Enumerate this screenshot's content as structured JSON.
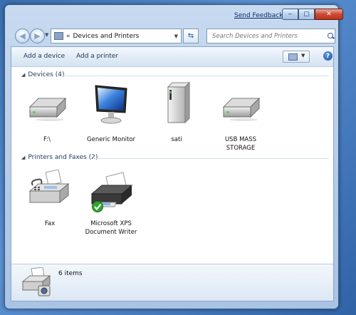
{
  "title_bar": {
    "send_feedback": "Send Feedback",
    "min_glyph": "‒",
    "max_glyph": "▢",
    "close_glyph": "✕"
  },
  "nav": {
    "back_glyph": "◀",
    "forward_glyph": "▶",
    "breadcrumb_separator": "«",
    "breadcrumb": "Devices and Printers",
    "refresh_glyph": "⇆",
    "search_placeholder": "Search Devices and Printers"
  },
  "toolbar": {
    "add_device": "Add a device",
    "add_printer": "Add a printer",
    "help": "?"
  },
  "groups": [
    {
      "header": "Devices (4)",
      "items": [
        {
          "label": [
            "F:\\"
          ],
          "icon": "external-drive-icon"
        },
        {
          "label": [
            "Generic Monitor"
          ],
          "icon": "monitor-icon"
        },
        {
          "label": [
            "sati"
          ],
          "icon": "computer-tower-icon"
        },
        {
          "label": [
            "USB MASS",
            "STORAGE"
          ],
          "icon": "external-drive-icon"
        }
      ]
    },
    {
      "header": "Printers and Faxes (2)",
      "items": [
        {
          "label": [
            "Fax"
          ],
          "icon": "fax-icon"
        },
        {
          "label": [
            "Microsoft XPS",
            "Document Writer"
          ],
          "icon": "printer-default-icon"
        }
      ]
    }
  ],
  "status": {
    "count": "6 items",
    "icon": "devices-printer-icon"
  },
  "colors": {
    "accent": "#1e5aa8",
    "default_check": "#2ea52e"
  }
}
